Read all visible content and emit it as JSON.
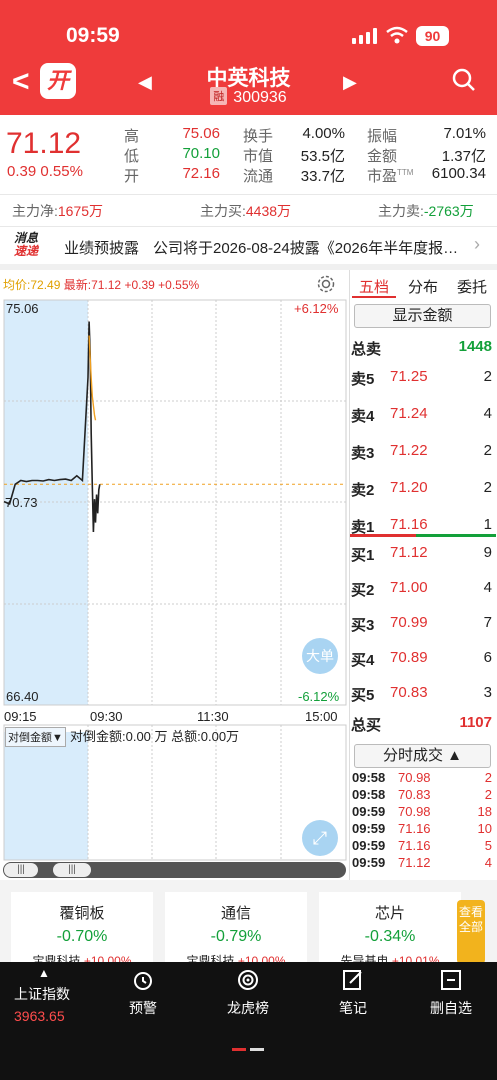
{
  "status_bar": {
    "time": "09:59",
    "battery": "90"
  },
  "header": {
    "open_badge": "开",
    "stock_name": "中英科技",
    "margin_tag": "融",
    "stock_code": "300936"
  },
  "quote": {
    "last_price": "71.12",
    "change": "0.39",
    "change_pct": "0.55%",
    "high_label": "高",
    "high": "75.06",
    "low_label": "低",
    "low": "70.10",
    "open_label": "开",
    "open": "72.16",
    "turnover_label": "换手",
    "turnover": "4.00%",
    "mktcap_label": "市值",
    "mktcap": "53.5亿",
    "float_label": "流通",
    "float": "33.7亿",
    "amplitude_label": "振幅",
    "amplitude": "7.01%",
    "amount_label": "金额",
    "amount": "1.37亿",
    "pe_label": "市盈",
    "pe_tm": "TTM",
    "pe": "6100.34"
  },
  "fund_flow": {
    "net_label": "主力净:",
    "net": "1675万",
    "buy_label": "主力买:",
    "buy": "4438万",
    "sell_label": "主力卖:",
    "sell": "-2763万"
  },
  "news": {
    "logo_line1": "消息",
    "logo_line2": "速递",
    "category": "业绩预披露",
    "text": "公司将于2026-08-24披露《2026年半年度报告》"
  },
  "chart": {
    "avg_label": "均价:",
    "avg": "72.49",
    "latest_label": "最新:",
    "latest": "71.12",
    "latest_chg": "+0.39",
    "latest_pct": "+0.55%",
    "y_top": "75.06",
    "y_mid": "70.73",
    "y_bottom": "66.40",
    "pct_top": "+6.12%",
    "pct_bottom": "-6.12%",
    "times": [
      "09:15",
      "09:30",
      "11:30",
      "15:00"
    ],
    "big_order_btn": "大单",
    "sub_select": "对倒金额▼",
    "sub_info": "对倒金额:0.00 万 总额:0.00万"
  },
  "chart_data": {
    "type": "line",
    "title": "",
    "ylim": [
      66.4,
      75.06
    ],
    "series": [
      {
        "name": "价格",
        "color": "#222222",
        "x": [
          "09:15",
          "09:16",
          "09:17",
          "09:18",
          "09:19",
          "09:20",
          "09:21",
          "09:22",
          "09:23",
          "09:24",
          "09:25",
          "09:26",
          "09:27",
          "09:28",
          "09:29",
          "09:30",
          "09:31",
          "09:32",
          "09:33",
          "09:34",
          "09:35",
          "09:36",
          "09:37",
          "09:38",
          "09:39",
          "09:40",
          "09:41"
        ],
        "values": [
          70.75,
          70.7,
          71.12,
          71.2,
          71.18,
          71.2,
          71.2,
          71.19,
          71.22,
          71.2,
          71.22,
          71.23,
          71.2,
          71.3,
          71.2,
          73.4,
          74.6,
          73.9,
          72.2,
          71.1,
          70.1,
          70.8,
          70.3,
          70.9,
          70.5,
          71.0,
          71.12
        ]
      },
      {
        "name": "均价",
        "color": "#f0a020",
        "x": [
          "09:31",
          "09:32",
          "09:33",
          "09:34",
          "09:35",
          "09:36",
          "09:37"
        ],
        "values": [
          74.3,
          73.8,
          73.4,
          73.0,
          72.8,
          72.6,
          72.49
        ]
      }
    ]
  },
  "order_book": {
    "tabs": [
      "五档",
      "分布",
      "委托"
    ],
    "show_amount": "显示金额",
    "total_sell_label": "总卖",
    "total_sell": "1448",
    "asks": [
      {
        "label": "卖5",
        "price": "71.25",
        "qty": "2"
      },
      {
        "label": "卖4",
        "price": "71.24",
        "qty": "4"
      },
      {
        "label": "卖3",
        "price": "71.22",
        "qty": "2"
      },
      {
        "label": "卖2",
        "price": "71.20",
        "qty": "2"
      },
      {
        "label": "卖1",
        "price": "71.16",
        "qty": "1"
      }
    ],
    "bids": [
      {
        "label": "买1",
        "price": "71.12",
        "qty": "9"
      },
      {
        "label": "买2",
        "price": "71.00",
        "qty": "4"
      },
      {
        "label": "买3",
        "price": "70.99",
        "qty": "7"
      },
      {
        "label": "买4",
        "price": "70.89",
        "qty": "6"
      },
      {
        "label": "买5",
        "price": "70.83",
        "qty": "3"
      }
    ],
    "total_buy_label": "总买",
    "total_buy": "1107",
    "trades_btn": "分时成交 ▲",
    "trades": [
      {
        "time": "09:58",
        "price": "70.98",
        "qty": "2"
      },
      {
        "time": "09:58",
        "price": "70.83",
        "qty": "2"
      },
      {
        "time": "09:59",
        "price": "70.98",
        "qty": "18"
      },
      {
        "time": "09:59",
        "price": "71.16",
        "qty": "10"
      },
      {
        "time": "09:59",
        "price": "71.16",
        "qty": "5"
      },
      {
        "time": "09:59",
        "price": "71.12",
        "qty": "4"
      }
    ]
  },
  "sectors": [
    {
      "name": "覆铜板",
      "change": "-0.70%",
      "leader": "宝鼎科技",
      "leader_chg": "+10.00%"
    },
    {
      "name": "通信",
      "change": "-0.79%",
      "leader": "宝鼎科技",
      "leader_chg": "+10.00%"
    },
    {
      "name": "芯片",
      "change": "-0.34%",
      "leader": "先导基电",
      "leader_chg": "+10.01%"
    }
  ],
  "view_all": "查看全部",
  "bottom_nav": {
    "index_name": "上证指数",
    "index_value": "3963.65",
    "items": [
      "预警",
      "龙虎榜",
      "笔记",
      "删自选"
    ]
  }
}
